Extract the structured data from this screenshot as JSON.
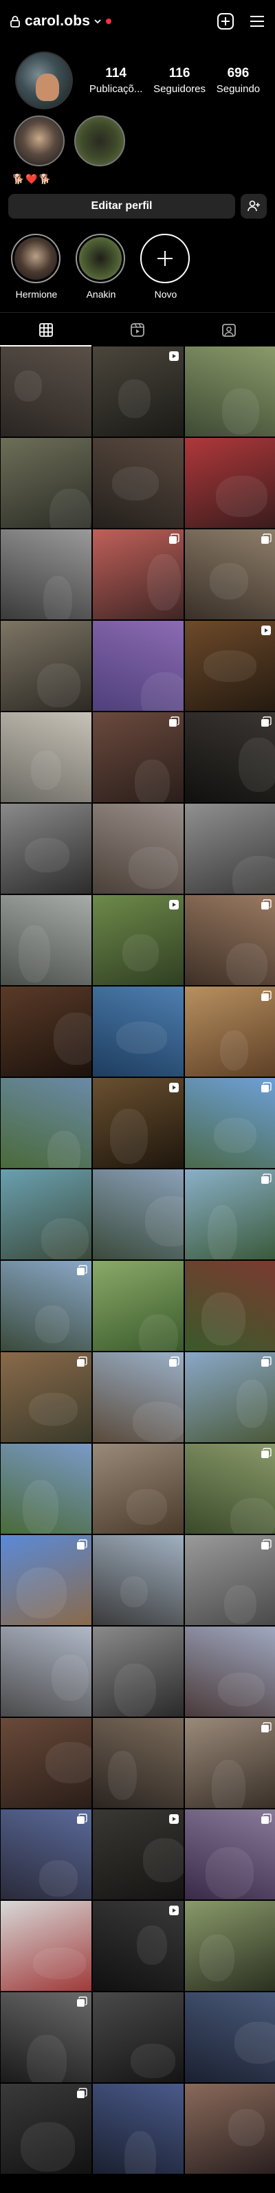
{
  "header": {
    "username": "carol.obs",
    "icons": [
      "lock-icon",
      "chevron-down-icon",
      "notification-dot",
      "add-post-icon",
      "menu-icon"
    ]
  },
  "profile": {
    "stats": [
      {
        "num": "114",
        "label": "Publicaçõ..."
      },
      {
        "num": "116",
        "label": "Seguidores"
      },
      {
        "num": "696",
        "label": "Seguindo"
      }
    ],
    "bio": "🐕❤️🐕",
    "edit_label": "Editar perfil"
  },
  "highlights": [
    {
      "label": "Hermione"
    },
    {
      "label": "Anakin"
    },
    {
      "label": "Novo"
    }
  ],
  "tabs": [
    "grid-tab",
    "reels-tab",
    "tagged-tab"
  ],
  "grid": [
    {
      "c1": "#5a5048",
      "c2": "#2a2522",
      "badge": ""
    },
    {
      "c1": "#4a463c",
      "c2": "#1b1a16",
      "badge": "reel"
    },
    {
      "c1": "#8a9a6a",
      "c2": "#3e4a33",
      "badge": ""
    },
    {
      "c1": "#6e6f58",
      "c2": "#2b2d26",
      "badge": ""
    },
    {
      "c1": "#5a4a40",
      "c2": "#24201c",
      "badge": ""
    },
    {
      "c1": "#b0383b",
      "c2": "#3a1c1c",
      "badge": ""
    },
    {
      "c1": "#9a9a9a",
      "c2": "#3a3a3a",
      "badge": ""
    },
    {
      "c1": "#c06058",
      "c2": "#3f2525",
      "badge": "multi"
    },
    {
      "c1": "#8e7e6a",
      "c2": "#3a3028",
      "badge": "multi"
    },
    {
      "c1": "#7d7565",
      "c2": "#2d2a24",
      "badge": ""
    },
    {
      "c1": "#8c6bb3",
      "c2": "#4e3f7a",
      "badge": ""
    },
    {
      "c1": "#6e4a2a",
      "c2": "#241a10",
      "badge": "reel"
    },
    {
      "c1": "#c7c2b8",
      "c2": "#6b6a62",
      "badge": ""
    },
    {
      "c1": "#6b4a3e",
      "c2": "#2a1e1a",
      "badge": "multi"
    },
    {
      "c1": "#3a3632",
      "c2": "#11100e",
      "badge": "multi"
    },
    {
      "c1": "#8a8a8a",
      "c2": "#2c2c2c",
      "badge": ""
    },
    {
      "c1": "#9a8f8a",
      "c2": "#4a4038",
      "badge": ""
    },
    {
      "c1": "#909090",
      "c2": "#3a3a3a",
      "badge": ""
    },
    {
      "c1": "#a7aca8",
      "c2": "#4b4f4b",
      "badge": ""
    },
    {
      "c1": "#6e8a4a",
      "c2": "#2f3f22",
      "badge": "reel"
    },
    {
      "c1": "#9a7a62",
      "c2": "#3e3026",
      "badge": "multi"
    },
    {
      "c1": "#5a3a28",
      "c2": "#1b120c",
      "badge": ""
    },
    {
      "c1": "#4e7eb0",
      "c2": "#1d3d5e",
      "badge": ""
    },
    {
      "c1": "#b89060",
      "c2": "#5e4026",
      "badge": "multi"
    },
    {
      "c1": "#6a8aa8",
      "c2": "#4a6a3a",
      "badge": ""
    },
    {
      "c1": "#6a5030",
      "c2": "#1e160c",
      "badge": "reel"
    },
    {
      "c1": "#6ea0d8",
      "c2": "#4a6a4a",
      "badge": "multi"
    },
    {
      "c1": "#6aa0b0",
      "c2": "#3a4a3a",
      "badge": ""
    },
    {
      "c1": "#8aa0b8",
      "c2": "#3a4a3a",
      "badge": ""
    },
    {
      "c1": "#8ab0c8",
      "c2": "#3a5a3a",
      "badge": "multi"
    },
    {
      "c1": "#8aa8c8",
      "c2": "#3a4a3a",
      "badge": "multi"
    },
    {
      "c1": "#8aaa6a",
      "c2": "#3a5a2a",
      "badge": ""
    },
    {
      "c1": "#7a3a30",
      "c2": "#3a5a2a",
      "badge": ""
    },
    {
      "c1": "#8a6a4a",
      "c2": "#3a3a2a",
      "badge": "multi"
    },
    {
      "c1": "#9ab0c8",
      "c2": "#5a4a3a",
      "badge": "multi"
    },
    {
      "c1": "#8aa8c8",
      "c2": "#4a5a3a",
      "badge": "multi"
    },
    {
      "c1": "#7a9ac8",
      "c2": "#4a6a3a",
      "badge": ""
    },
    {
      "c1": "#9a8a7a",
      "c2": "#4a3a2a",
      "badge": ""
    },
    {
      "c1": "#8a9a6a",
      "c2": "#3a4a2a",
      "badge": "multi"
    },
    {
      "c1": "#5a8ad8",
      "c2": "#8a6a4a",
      "badge": "multi"
    },
    {
      "c1": "#a0b0c0",
      "c2": "#3a3a3a",
      "badge": ""
    },
    {
      "c1": "#9a9a9a",
      "c2": "#4a4a4a",
      "badge": "multi"
    },
    {
      "c1": "#b0b8c8",
      "c2": "#4a4a4a",
      "badge": ""
    },
    {
      "c1": "#8a8a8a",
      "c2": "#2a2a2a",
      "badge": ""
    },
    {
      "c1": "#a0a8c0",
      "c2": "#4a3a3a",
      "badge": ""
    },
    {
      "c1": "#6a4a3a",
      "c2": "#2a1e18",
      "badge": ""
    },
    {
      "c1": "#7a6a5a",
      "c2": "#2a2420",
      "badge": ""
    },
    {
      "c1": "#9a8a7a",
      "c2": "#3a3028",
      "badge": "multi"
    },
    {
      "c1": "#5a6a9a",
      "c2": "#2a2a3a",
      "badge": "multi"
    },
    {
      "c1": "#3a3834",
      "c2": "#151412",
      "badge": "reel"
    },
    {
      "c1": "#8a7a9a",
      "c2": "#3a2a4a",
      "badge": "multi"
    },
    {
      "c1": "#d8d8d8",
      "c2": "#a03a3a",
      "badge": ""
    },
    {
      "c1": "#3a3a3a",
      "c2": "#101010",
      "badge": "reel"
    },
    {
      "c1": "#8a9a6a",
      "c2": "#2a3020",
      "badge": ""
    },
    {
      "c1": "#6a6a6a",
      "c2": "#1a1a1a",
      "badge": "multi"
    },
    {
      "c1": "#4a4a4a",
      "c2": "#141414",
      "badge": ""
    },
    {
      "c1": "#4a5a7a",
      "c2": "#1a2030",
      "badge": ""
    },
    {
      "c1": "#3a3a3a",
      "c2": "#121212",
      "badge": "multi"
    },
    {
      "c1": "#4a5a8a",
      "c2": "#1a2030",
      "badge": ""
    },
    {
      "c1": "#8a6a5a",
      "c2": "#2a2020",
      "badge": ""
    }
  ]
}
